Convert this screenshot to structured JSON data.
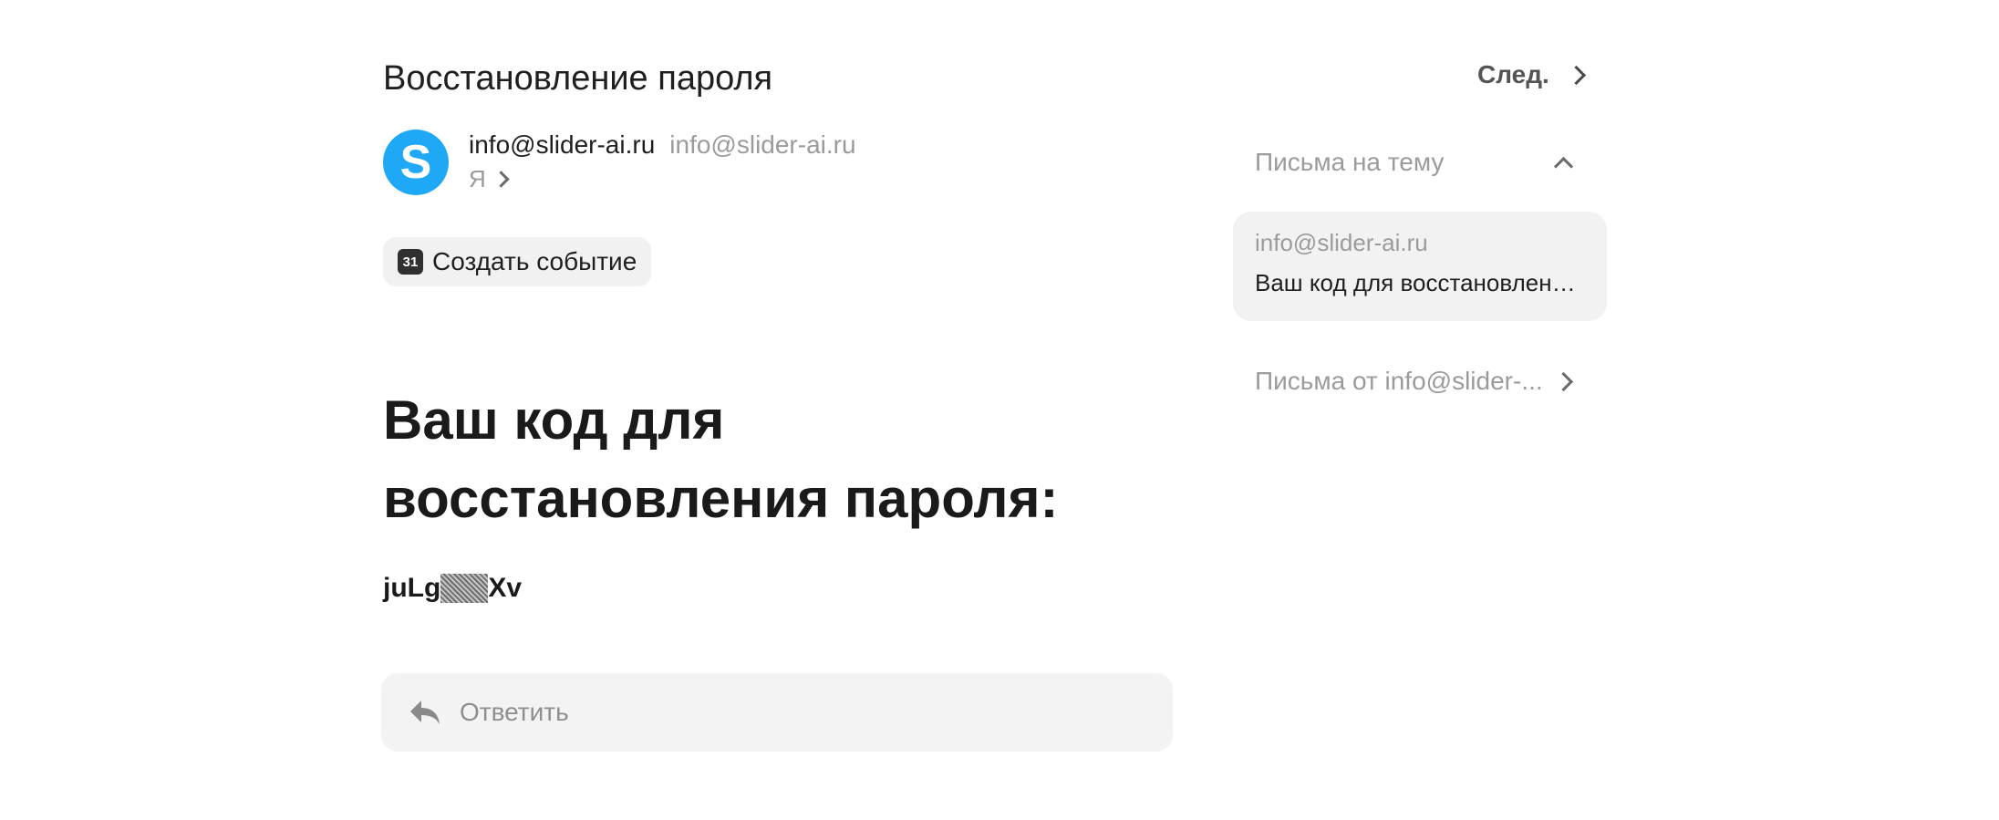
{
  "message": {
    "subject": "Восстановление пароля",
    "sender_name": "info@slider-ai.ru",
    "sender_email": "info@slider-ai.ru",
    "avatar_letter": "S",
    "recipient": "Я",
    "create_event_label": "Создать событие",
    "calendar_day": "31",
    "body_heading": "Ваш код для восстановления пароля:",
    "code_prefix": "juLg",
    "code_suffix": "Xv",
    "reply_label": "Ответить"
  },
  "nav": {
    "next_label": "След."
  },
  "sidebar": {
    "thread_header": "Письма на тему",
    "thread_item": {
      "from": "info@slider-ai.ru",
      "subject": "Ваш код для восстановления..."
    },
    "from_link": "Письма от info@slider-..."
  },
  "colors": {
    "avatar": "#1fa8f5",
    "panel": "#f2f2f2"
  }
}
